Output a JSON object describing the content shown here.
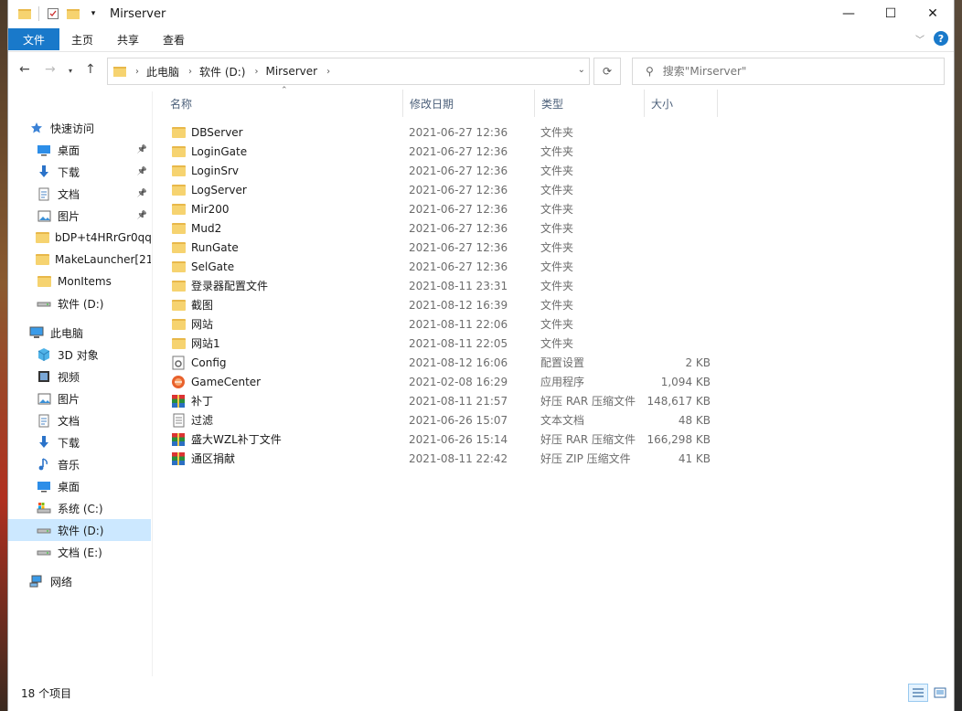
{
  "window": {
    "title": "Mirserver",
    "minimize_label": "—",
    "maximize_label": "☐",
    "close_label": "✕"
  },
  "ribbon": {
    "tabs": [
      "文件",
      "主页",
      "共享",
      "查看"
    ],
    "help_label": "?"
  },
  "address": {
    "crumbs": [
      "此电脑",
      "软件 (D:)",
      "Mirserver"
    ],
    "search_placeholder": "搜索\"Mirserver\""
  },
  "nav": {
    "items": [
      {
        "label": "快速访问",
        "icon": "star-icon",
        "pinned": false
      },
      {
        "label": "桌面",
        "icon": "desktop-icon",
        "pinned": true
      },
      {
        "label": "下载",
        "icon": "download-icon",
        "pinned": true
      },
      {
        "label": "文档",
        "icon": "document-icon",
        "pinned": true
      },
      {
        "label": "图片",
        "icon": "picture-icon",
        "pinned": true
      },
      {
        "label": "bDP+t4HRrGr0qq",
        "icon": "folder-icon",
        "pinned": false
      },
      {
        "label": "MakeLauncher[21",
        "icon": "folder-icon",
        "pinned": false
      },
      {
        "label": "MonItems",
        "icon": "folder-icon",
        "pinned": false
      },
      {
        "label": "软件 (D:)",
        "icon": "drive-icon",
        "pinned": false
      },
      {
        "label": "此电脑",
        "icon": "computer-icon",
        "pinned": false
      },
      {
        "label": "3D 对象",
        "icon": "3d-objects-icon",
        "pinned": false
      },
      {
        "label": "视频",
        "icon": "video-icon",
        "pinned": false
      },
      {
        "label": "图片",
        "icon": "picture-icon",
        "pinned": false
      },
      {
        "label": "文档",
        "icon": "document-icon",
        "pinned": false
      },
      {
        "label": "下载",
        "icon": "download-icon",
        "pinned": false
      },
      {
        "label": "音乐",
        "icon": "music-icon",
        "pinned": false
      },
      {
        "label": "桌面",
        "icon": "desktop-icon",
        "pinned": false
      },
      {
        "label": "系统 (C:)",
        "icon": "system-drive-icon",
        "pinned": false
      },
      {
        "label": "软件 (D:)",
        "icon": "drive-icon",
        "pinned": false,
        "selected": true
      },
      {
        "label": "文档 (E:)",
        "icon": "drive-icon",
        "pinned": false
      },
      {
        "label": "网络",
        "icon": "network-icon",
        "pinned": false
      }
    ]
  },
  "columns": {
    "name": "名称",
    "date": "修改日期",
    "type": "类型",
    "size": "大小"
  },
  "files": [
    {
      "name": "DBServer",
      "date": "2021-06-27 12:36",
      "type": "文件夹",
      "size": "",
      "icon": "folder-icon"
    },
    {
      "name": "LoginGate",
      "date": "2021-06-27 12:36",
      "type": "文件夹",
      "size": "",
      "icon": "folder-icon"
    },
    {
      "name": "LoginSrv",
      "date": "2021-06-27 12:36",
      "type": "文件夹",
      "size": "",
      "icon": "folder-icon"
    },
    {
      "name": "LogServer",
      "date": "2021-06-27 12:36",
      "type": "文件夹",
      "size": "",
      "icon": "folder-icon"
    },
    {
      "name": "Mir200",
      "date": "2021-06-27 12:36",
      "type": "文件夹",
      "size": "",
      "icon": "folder-icon"
    },
    {
      "name": "Mud2",
      "date": "2021-06-27 12:36",
      "type": "文件夹",
      "size": "",
      "icon": "folder-icon"
    },
    {
      "name": "RunGate",
      "date": "2021-06-27 12:36",
      "type": "文件夹",
      "size": "",
      "icon": "folder-icon"
    },
    {
      "name": "SelGate",
      "date": "2021-06-27 12:36",
      "type": "文件夹",
      "size": "",
      "icon": "folder-icon"
    },
    {
      "name": "登录器配置文件",
      "date": "2021-08-11 23:31",
      "type": "文件夹",
      "size": "",
      "icon": "folder-icon"
    },
    {
      "name": "截图",
      "date": "2021-08-12 16:39",
      "type": "文件夹",
      "size": "",
      "icon": "folder-icon"
    },
    {
      "name": "网站",
      "date": "2021-08-11 22:06",
      "type": "文件夹",
      "size": "",
      "icon": "folder-icon"
    },
    {
      "name": "网站1",
      "date": "2021-08-11 22:05",
      "type": "文件夹",
      "size": "",
      "icon": "folder-icon"
    },
    {
      "name": "Config",
      "date": "2021-08-12 16:06",
      "type": "配置设置",
      "size": "2 KB",
      "icon": "config-file-icon"
    },
    {
      "name": "GameCenter",
      "date": "2021-02-08 16:29",
      "type": "应用程序",
      "size": "1,094 KB",
      "icon": "app-icon"
    },
    {
      "name": "补丁",
      "date": "2021-08-11 21:57",
      "type": "好压 RAR 压缩文件",
      "size": "148,617 KB",
      "icon": "archive-icon"
    },
    {
      "name": "过滤",
      "date": "2021-06-26 15:07",
      "type": "文本文档",
      "size": "48 KB",
      "icon": "text-file-icon"
    },
    {
      "name": "盛大WZL补丁文件",
      "date": "2021-06-26 15:14",
      "type": "好压 RAR 压缩文件",
      "size": "166,298 KB",
      "icon": "archive-icon"
    },
    {
      "name": "通区捐献",
      "date": "2021-08-11 22:42",
      "type": "好压 ZIP 压缩文件",
      "size": "41 KB",
      "icon": "archive-icon"
    }
  ],
  "status": {
    "count": "18 个项目"
  }
}
